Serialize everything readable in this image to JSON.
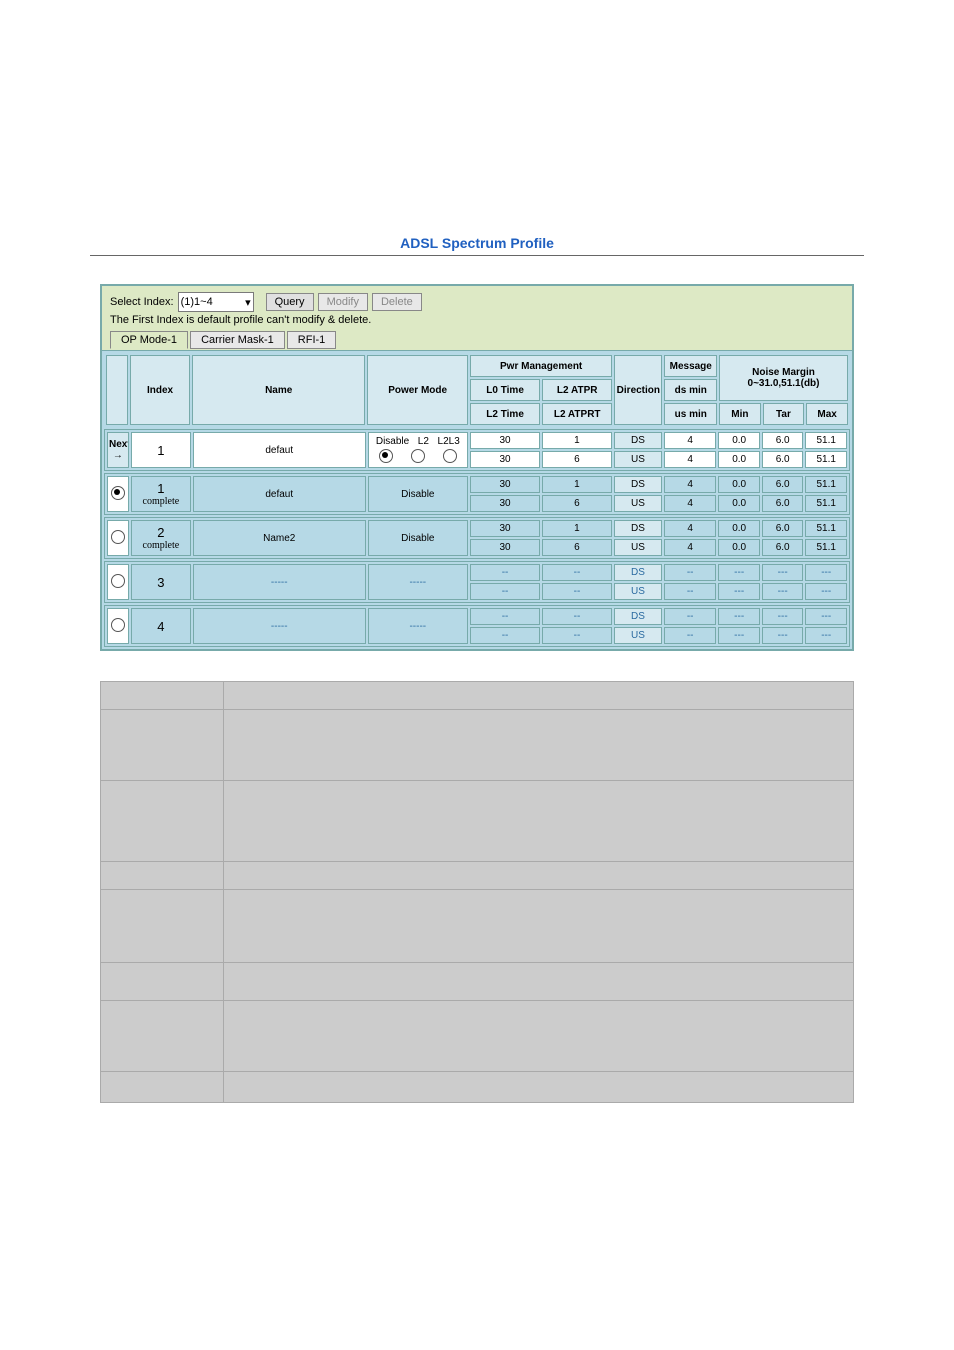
{
  "title": "ADSL Spectrum Profile",
  "toolbar": {
    "select_label": "Select Index:",
    "select_value": "(1)1~4",
    "query": "Query",
    "modify": "Modify",
    "delete": "Delete",
    "note": "The First Index is default profile can't modify & delete."
  },
  "tabs": {
    "t1": "OP Mode-1",
    "t2": "Carrier Mask-1",
    "t3": "RFI-1"
  },
  "hdr": {
    "index": "Index",
    "name": "Name",
    "power": "Power\nMode",
    "pwrmg": "Pwr Management",
    "l0time": "L0 Time",
    "l2atpr": "L2 ATPR",
    "l2time": "L2 Time",
    "l2atprt": "L2 ATPRT",
    "direction": "Direction",
    "message": "Message",
    "dsmin": "ds min",
    "usmin": "us min",
    "noise": "Noise Margin",
    "noise2": "0~31.0,51.1(db)",
    "min": "Min",
    "tar": "Tar",
    "max": "Max"
  },
  "pm": {
    "a": "Disable",
    "b": "L2",
    "c": "L2L3"
  },
  "next": {
    "label": "Next",
    "arrow": "→"
  },
  "rows": [
    {
      "kind": "next",
      "index": "1",
      "name": "defaut",
      "r": [
        {
          "l0": "30",
          "l2a": "1",
          "dir": "DS",
          "msg": "4",
          "min": "0.0",
          "tar": "6.0",
          "max": "51.1"
        },
        {
          "l0": "30",
          "l2a": "6",
          "dir": "US",
          "msg": "4",
          "min": "0.0",
          "tar": "6.0",
          "max": "51.1"
        }
      ]
    },
    {
      "kind": "data",
      "selected": true,
      "index": "1",
      "status": "complete",
      "name": "defaut",
      "power": "Disable",
      "r": [
        {
          "l0": "30",
          "l2a": "1",
          "dir": "DS",
          "msg": "4",
          "min": "0.0",
          "tar": "6.0",
          "max": "51.1"
        },
        {
          "l0": "30",
          "l2a": "6",
          "dir": "US",
          "msg": "4",
          "min": "0.0",
          "tar": "6.0",
          "max": "51.1"
        }
      ]
    },
    {
      "kind": "data",
      "selected": false,
      "index": "2",
      "status": "complete",
      "name": "Name2",
      "power": "Disable",
      "r": [
        {
          "l0": "30",
          "l2a": "1",
          "dir": "DS",
          "msg": "4",
          "min": "0.0",
          "tar": "6.0",
          "max": "51.1"
        },
        {
          "l0": "30",
          "l2a": "6",
          "dir": "US",
          "msg": "4",
          "min": "0.0",
          "tar": "6.0",
          "max": "51.1"
        }
      ]
    },
    {
      "kind": "empty",
      "selected": false,
      "index": "3",
      "name": "-----",
      "power": "-----",
      "r": [
        {
          "l0": "--",
          "l2a": "--",
          "dir": "DS",
          "msg": "--",
          "min": "---",
          "tar": "---",
          "max": "---"
        },
        {
          "l0": "--",
          "l2a": "--",
          "dir": "US",
          "msg": "--",
          "min": "---",
          "tar": "---",
          "max": "---"
        }
      ]
    },
    {
      "kind": "empty",
      "selected": false,
      "index": "4",
      "name": "-----",
      "power": "-----",
      "r": [
        {
          "l0": "--",
          "l2a": "--",
          "dir": "DS",
          "msg": "--",
          "min": "---",
          "tar": "---",
          "max": "---"
        },
        {
          "l0": "--",
          "l2a": "--",
          "dir": "US",
          "msg": "--",
          "min": "---",
          "tar": "---",
          "max": "---"
        }
      ]
    }
  ],
  "desc_heights": [
    25,
    68,
    78,
    25,
    70,
    35,
    68,
    28
  ]
}
